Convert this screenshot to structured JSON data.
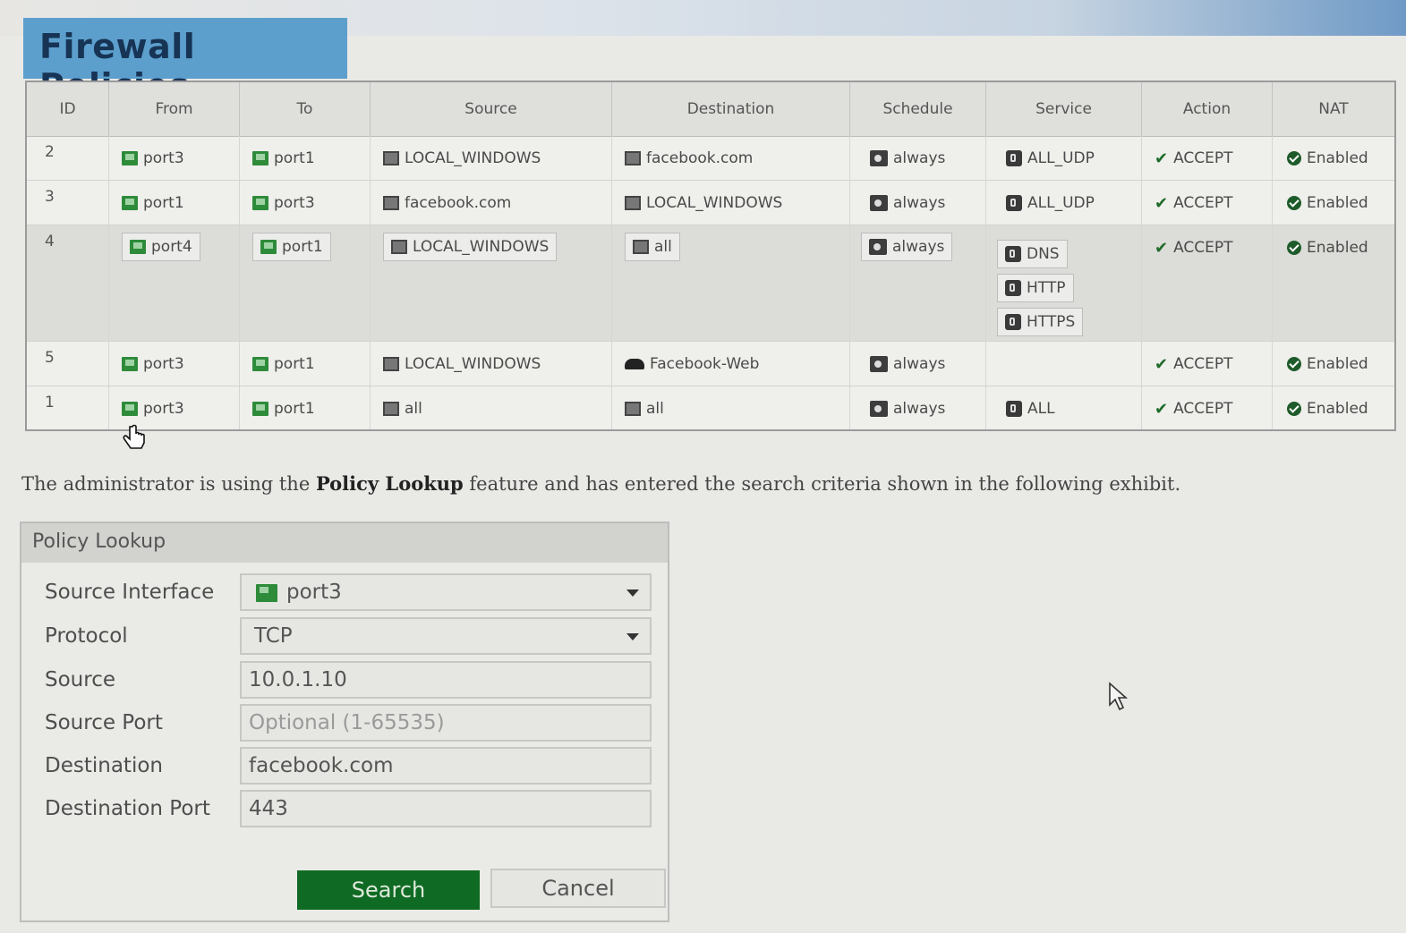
{
  "title": "Firewall Policies",
  "table": {
    "headers": [
      "ID",
      "From",
      "To",
      "Source",
      "Destination",
      "Schedule",
      "Service",
      "Action",
      "NAT"
    ],
    "rows": [
      {
        "id": "2",
        "from": "port3",
        "to": "port1",
        "source": "LOCAL_WINDOWS",
        "destination": "facebook.com",
        "schedule": "always",
        "services": [
          "ALL_UDP"
        ],
        "action": "ACCEPT",
        "nat": "Enabled"
      },
      {
        "id": "3",
        "from": "port1",
        "to": "port3",
        "source": "facebook.com",
        "destination": "LOCAL_WINDOWS",
        "schedule": "always",
        "services": [
          "ALL_UDP"
        ],
        "action": "ACCEPT",
        "nat": "Enabled"
      },
      {
        "id": "4",
        "from": "port4",
        "to": "port1",
        "source": "LOCAL_WINDOWS",
        "destination": "all",
        "schedule": "always",
        "services": [
          "DNS",
          "HTTP",
          "HTTPS"
        ],
        "action": "ACCEPT",
        "nat": "Enabled"
      },
      {
        "id": "5",
        "from": "port3",
        "to": "port1",
        "source": "LOCAL_WINDOWS",
        "destination": "Facebook-Web",
        "schedule": "always",
        "services": [],
        "action": "ACCEPT",
        "nat": "Enabled"
      },
      {
        "id": "1",
        "from": "port3",
        "to": "port1",
        "source": "all",
        "destination": "all",
        "schedule": "always",
        "services": [
          "ALL"
        ],
        "action": "ACCEPT",
        "nat": "Enabled"
      }
    ]
  },
  "sentence": {
    "before": "The administrator is using the ",
    "bold": "Policy Lookup",
    "after": " feature and has entered the search criteria shown in the following exhibit."
  },
  "lookup": {
    "title": "Policy Lookup",
    "fields": {
      "source_interface": {
        "label": "Source Interface",
        "value": "port3"
      },
      "protocol": {
        "label": "Protocol",
        "value": "TCP"
      },
      "source": {
        "label": "Source",
        "value": "10.0.1.10"
      },
      "source_port": {
        "label": "Source Port",
        "value": "",
        "placeholder": "Optional (1-65535)"
      },
      "destination": {
        "label": "Destination",
        "value": "facebook.com"
      },
      "destination_port": {
        "label": "Destination Port",
        "value": "443"
      }
    },
    "search_label": "Search",
    "cancel_label": "Cancel"
  }
}
